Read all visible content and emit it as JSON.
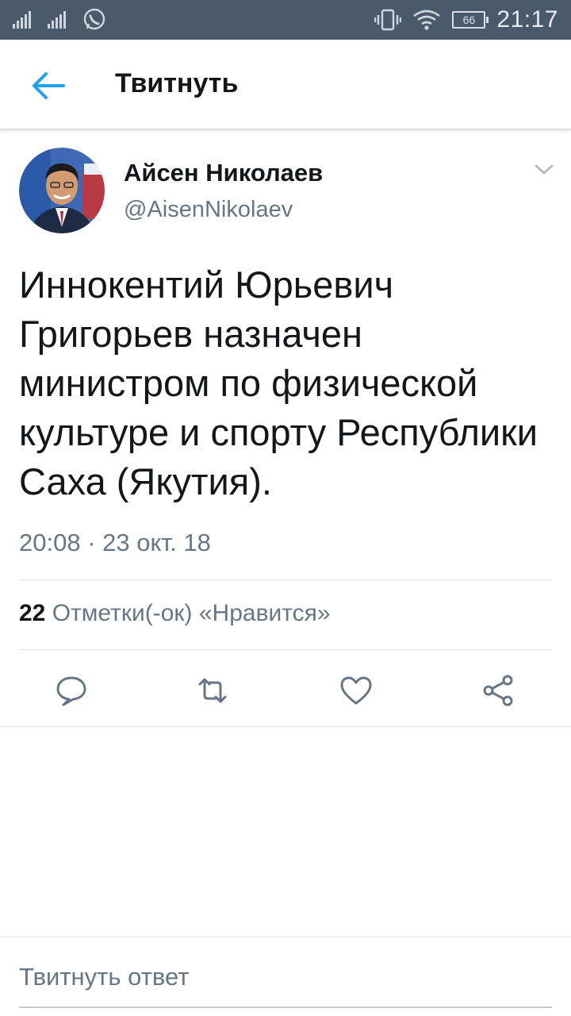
{
  "status_bar": {
    "time": "21:17",
    "battery": "66",
    "icons": [
      "signal-icon",
      "signal-icon",
      "whatsapp-icon",
      "vibrate-icon",
      "wifi-icon",
      "battery-icon"
    ]
  },
  "header": {
    "title": "Твитнуть",
    "back_icon": "arrow-left-icon",
    "accent_color": "#1da1f2"
  },
  "tweet": {
    "author_name": "Айсен Николаев",
    "author_handle": "@AisenNikolaev",
    "text": "Иннокентий Юрьевич Григорьев назначен министром по физической культуре и спорту Республики Саха (Якутия).",
    "timestamp": "20:08 · 23 окт. 18",
    "likes_count": "22",
    "likes_label": "Отметки(-ок) «Нравится»",
    "actions": [
      "reply-icon",
      "retweet-icon",
      "like-icon",
      "share-icon"
    ]
  },
  "reply": {
    "placeholder": "Твитнуть ответ"
  }
}
